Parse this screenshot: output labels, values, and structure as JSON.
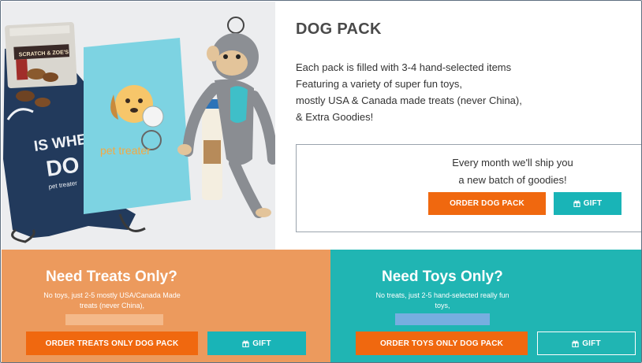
{
  "dog_pack": {
    "title": "DOG PACK",
    "description": [
      "Each pack is filled with 3-4 hand-selected items",
      "Featuring a variety of super fun toys,",
      "mostly USA & Canada made treats (never China),",
      "& Extra Goodies!"
    ],
    "ship_text": [
      "Every month we'll ship you",
      "a new batch of goodies!"
    ],
    "order_label": "ORDER DOG PACK",
    "gift_label": "GIFT"
  },
  "photo": {
    "jerky_label": "SCRATCH & ZOE'S",
    "bag_text": [
      "IS WHE",
      "DO"
    ],
    "bag_brand": "pet treater",
    "mailer_brand": "pet treater"
  },
  "treats_only": {
    "title": "Need Treats Only?",
    "text": [
      "No toys, just 2-5 mostly USA/Canada Made",
      "treats (never China),"
    ],
    "order_label": "ORDER TREATS ONLY DOG PACK",
    "gift_label": "GIFT"
  },
  "toys_only": {
    "title": "Need Toys Only?",
    "text": [
      "No treats, just 2-5 hand-selected really fun",
      "toys,"
    ],
    "order_label": "ORDER TOYS ONLY DOG PACK",
    "gift_label": "GIFT"
  },
  "colors": {
    "orange_button": "#f0680f",
    "teal_button": "#19b4b7",
    "treats_panel": "#ec9a5d",
    "toys_panel": "#20b5b3"
  }
}
